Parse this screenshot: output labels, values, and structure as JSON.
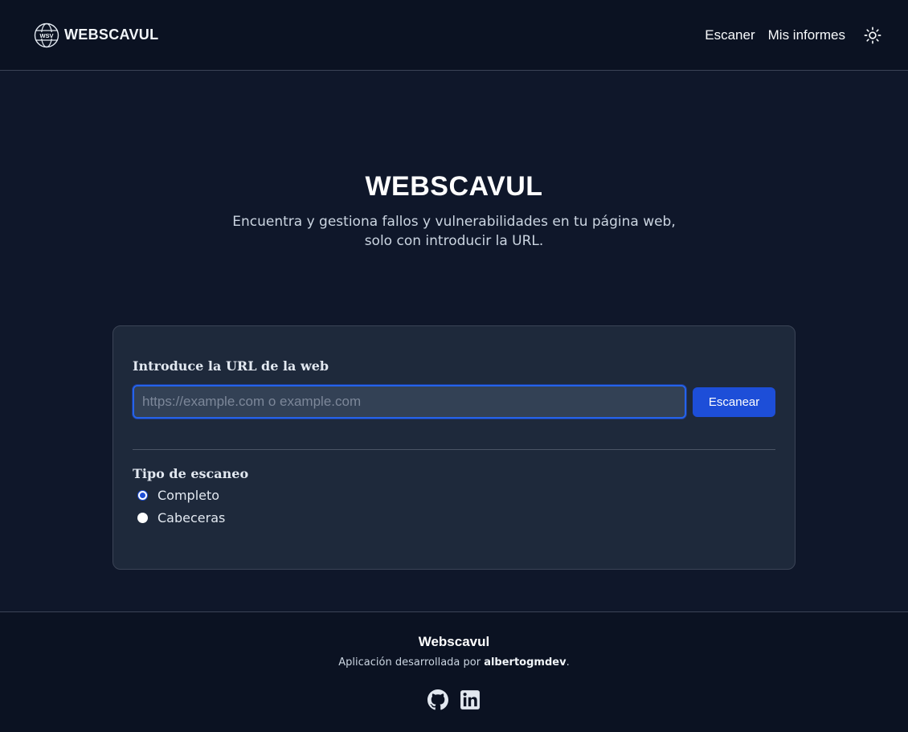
{
  "header": {
    "brand_logo_text": "WSV",
    "brand_name": "WEBSCAVUL",
    "nav": [
      {
        "label": "Escaner"
      },
      {
        "label": "Mis informes"
      }
    ],
    "theme_icon": "sun-icon"
  },
  "hero": {
    "title": "WEBSCAVUL",
    "subtitle_line1": "Encuentra y gestiona fallos y vulnerabilidades en tu página web,",
    "subtitle_line2": "solo con introducir la URL."
  },
  "form": {
    "url_label": "Introduce la URL de la web",
    "url_value": "",
    "url_placeholder": "https://example.com o example.com",
    "submit_label": "Escanear",
    "scan_type_label": "Tipo de escaneo",
    "scan_types": [
      {
        "label": "Completo",
        "selected": true
      },
      {
        "label": "Cabeceras",
        "selected": false
      }
    ]
  },
  "footer": {
    "title": "Webscavul",
    "credit_prefix": "Aplicación desarrollada por ",
    "credit_author": "albertogmdev",
    "credit_suffix": ".",
    "social_icons": [
      "github-icon",
      "linkedin-icon"
    ]
  },
  "colors": {
    "page_bg": "#0f172a",
    "bar_bg": "#0b1222",
    "card_bg": "#1e293b",
    "input_bg": "#334155",
    "accent": "#1d4ed8"
  }
}
